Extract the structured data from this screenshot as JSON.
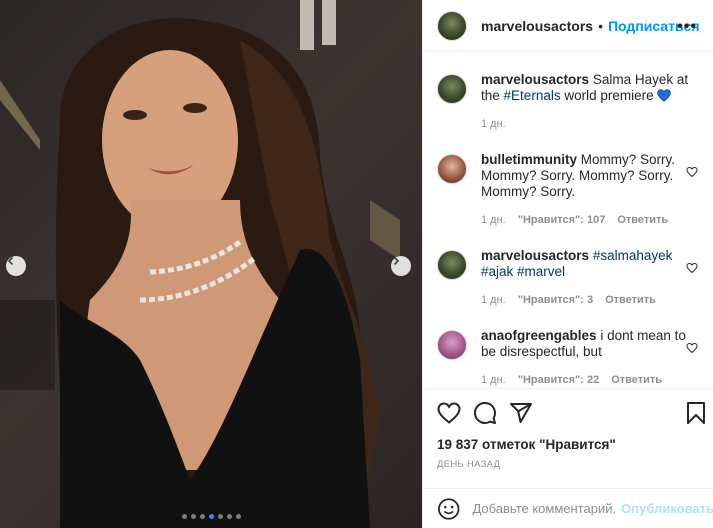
{
  "post": {
    "username": "marvelousactors",
    "separator": "•",
    "follow_label": "Подписаться",
    "more_icon": "more-icon"
  },
  "comments": [
    {
      "username": "marvelousactors",
      "text_before": "Salma Hayek at the",
      "tag": "#Eternals",
      "text_after": "world premiere",
      "emoji": "💙",
      "time": "1 дн.",
      "avatar_color": "#3a4a2b"
    },
    {
      "username": "bulletimmunity",
      "text": "Mommy? Sorry. Mommy? Sorry. Mommy? Sorry. Mommy? Sorry.",
      "time": "1 дн.",
      "likes": "\"Нравится\": 107",
      "reply": "Ответить"
    },
    {
      "username": "marvelousactors",
      "tags": "#salmahayek #ajak #marvel",
      "time": "1 дн.",
      "likes": "\"Нравится\": 3",
      "reply": "Ответить"
    },
    {
      "username": "anaofgreengables",
      "text": "i dont mean to be disrespectful, but",
      "time": "1 дн.",
      "likes": "\"Нравится\": 22",
      "reply": "Ответить"
    }
  ],
  "actions": {
    "likes_count": "19 837 отметок \"Нравится\"",
    "date": "ДЕНЬ НАЗАД"
  },
  "add_comment": {
    "placeholder": "Добавьте комментарий...",
    "post_label": "Опубликовать"
  },
  "carousel": {
    "dots_total": 7,
    "active_index": 3
  },
  "colors": {
    "accent": "#0095f6",
    "tag": "#00376b",
    "muted": "#8e8e8e",
    "active_dot": "#3b8cf0",
    "heart_emoji": "#1f6fe0"
  }
}
